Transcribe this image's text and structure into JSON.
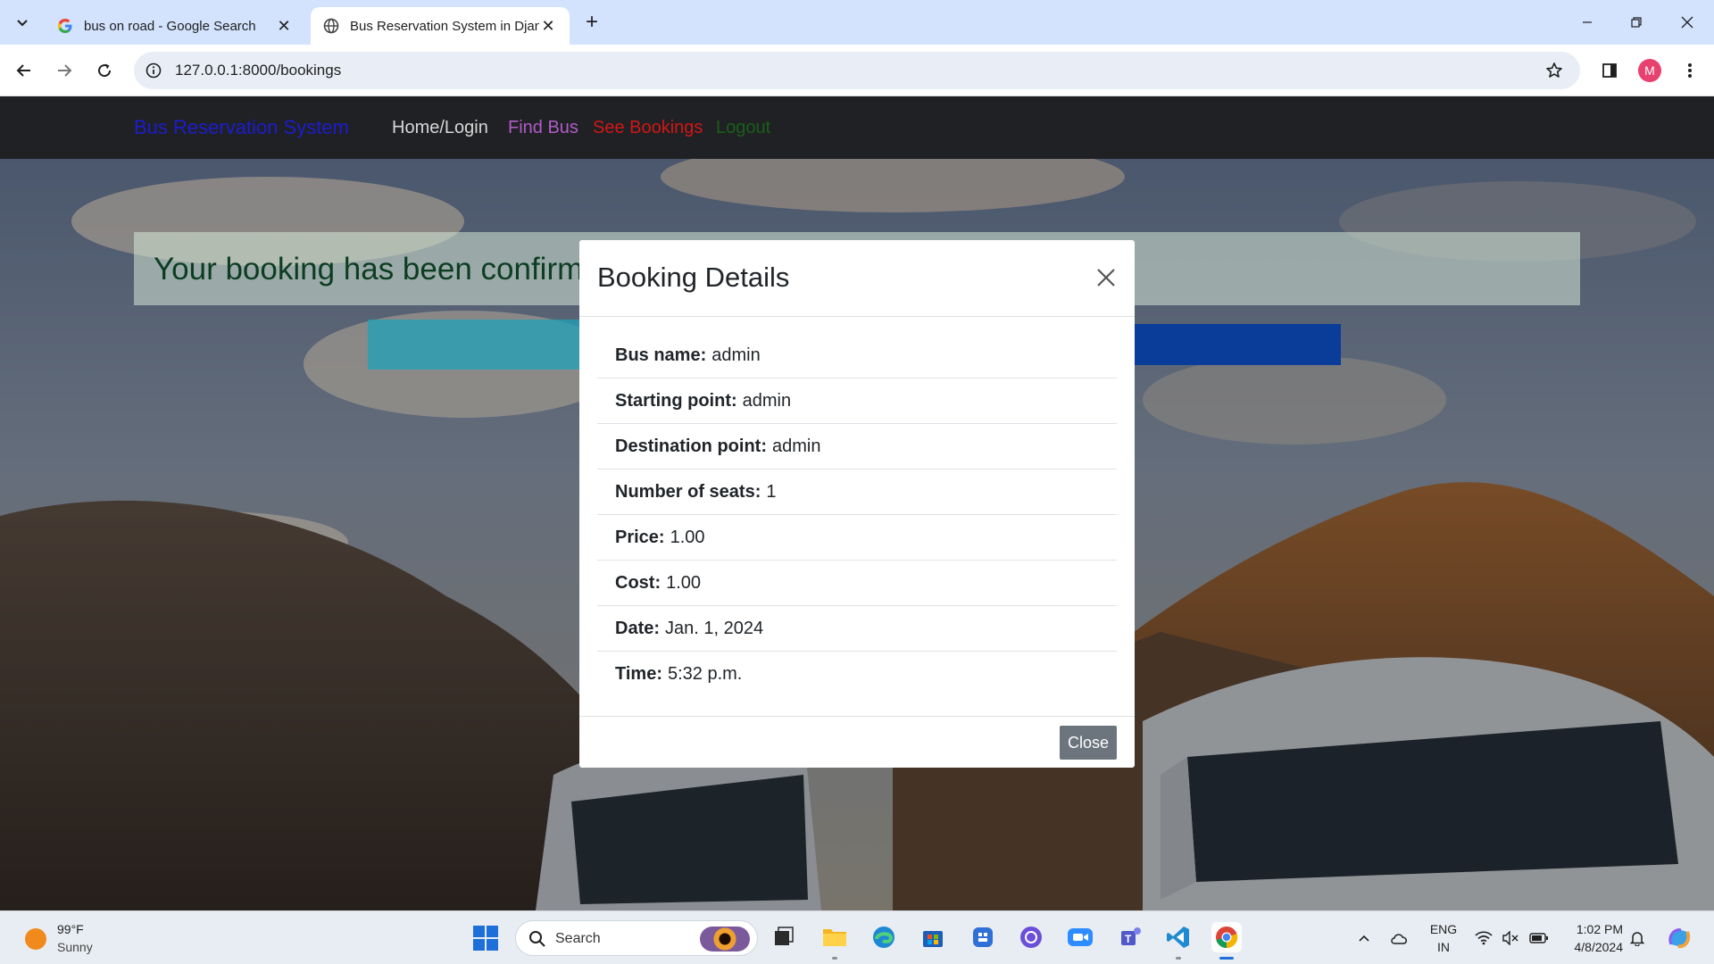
{
  "browser": {
    "tabs": [
      {
        "title": "bus on road - Google Search",
        "active": false,
        "favicon": "google-icon"
      },
      {
        "title": "Bus Reservation System in Django",
        "active": true,
        "favicon": "globe-icon"
      }
    ],
    "url": "127.0.0.1:8000/bookings",
    "profile_initial": "M"
  },
  "navbar": {
    "brand": "Bus Reservation System",
    "links": [
      {
        "label": "Home/Login",
        "color": "#d7d7d7"
      },
      {
        "label": "Find Bus",
        "color": "#b05cc8"
      },
      {
        "label": "See Bookings",
        "color": "#d11616"
      },
      {
        "label": "Logout",
        "color": "#1a5f1a"
      }
    ]
  },
  "alert": {
    "text": "Your booking has been confirmed"
  },
  "modal": {
    "title": "Booking Details",
    "details": [
      {
        "label": "Bus name:",
        "value": "admin"
      },
      {
        "label": "Starting point:",
        "value": "admin"
      },
      {
        "label": "Destination point:",
        "value": "admin"
      },
      {
        "label": "Number of seats:",
        "value": "1"
      },
      {
        "label": "Price:",
        "value": "1.00"
      },
      {
        "label": "Cost:",
        "value": "1.00"
      },
      {
        "label": "Date:",
        "value": "Jan. 1, 2024"
      },
      {
        "label": "Time:",
        "value": "5:32 p.m."
      }
    ],
    "close_label": "Close"
  },
  "taskbar": {
    "weather_temp": "99°F",
    "weather_condition": "Sunny",
    "search_placeholder": "Search",
    "lang_line1": "ENG",
    "lang_line2": "IN",
    "time": "1:02 PM",
    "date": "4/8/2024"
  }
}
